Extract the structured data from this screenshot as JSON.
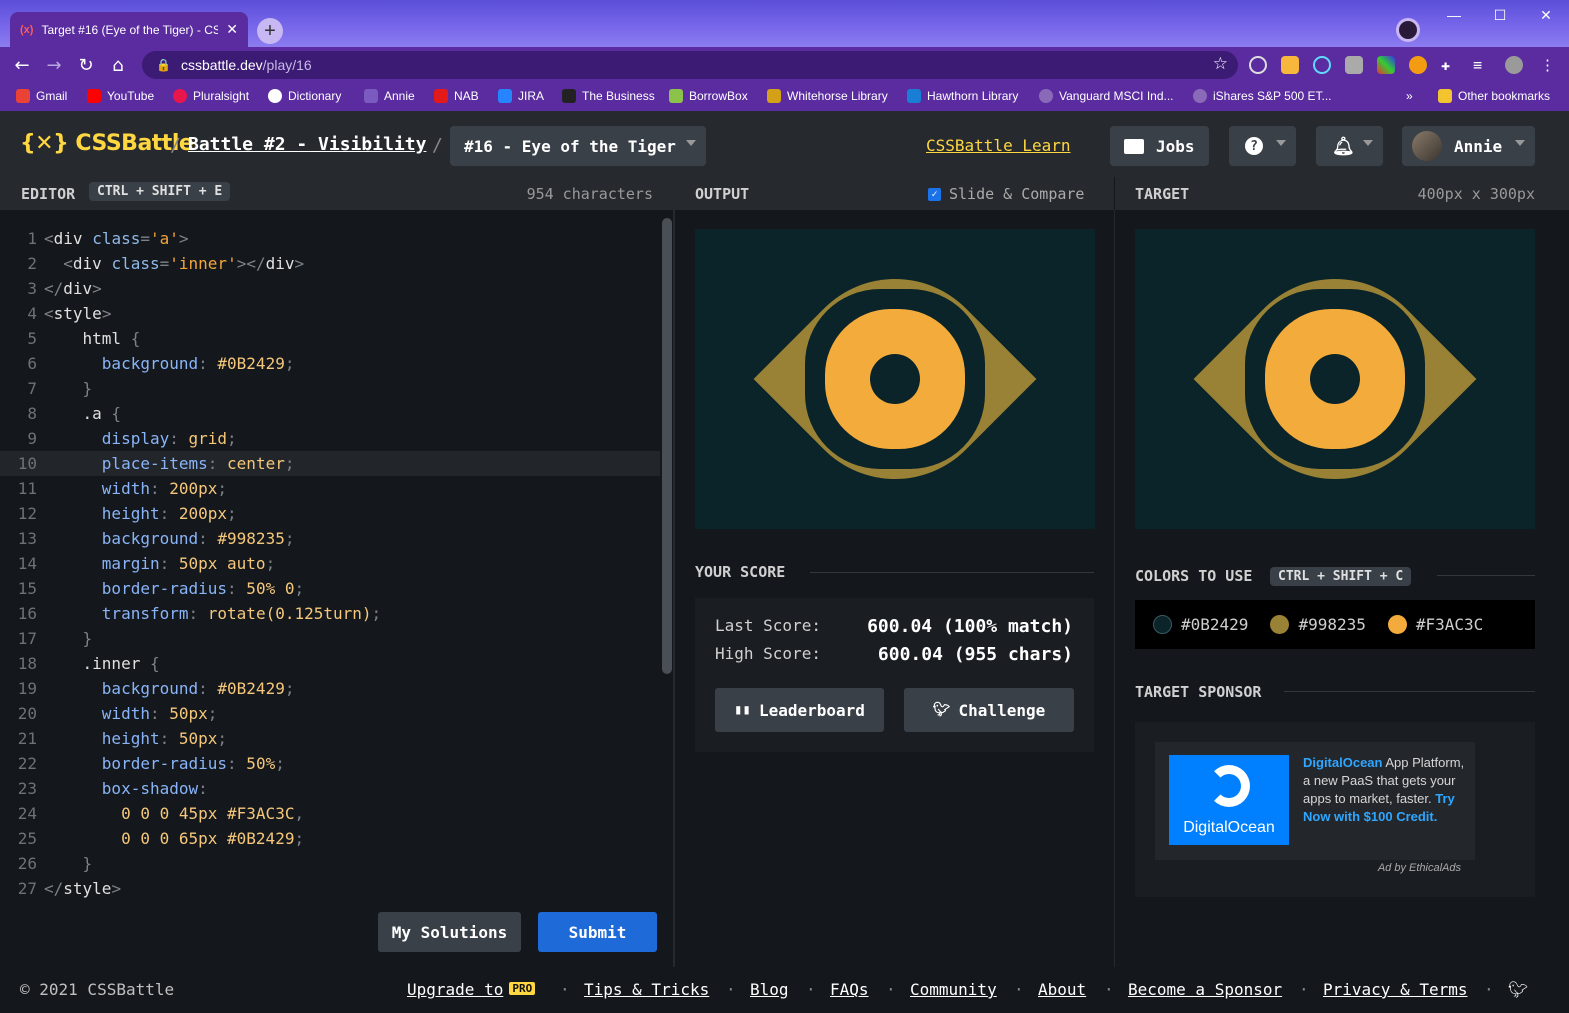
{
  "browser": {
    "tab_title": "Target #16 (Eye of the Tiger) - CSS",
    "tab_favicon": "(x)",
    "new_tab": "+",
    "url_host": "cssbattle.dev",
    "url_path": "/play/16",
    "more_bookmarks": "»",
    "bookmarks": [
      "Gmail",
      "YouTube",
      "Pluralsight",
      "Dictionary",
      "Annie",
      "NAB",
      "JIRA",
      "The Business",
      "BorrowBox",
      "Whitehorse Library",
      "Hawthorn Library",
      "Vanguard MSCI Ind...",
      "iShares S&P 500 ET...",
      "Other bookmarks"
    ]
  },
  "header": {
    "logo": "{✕} CSSBattle",
    "sep": "/",
    "battle": "Battle #2 - Visibility",
    "target": "#16 - Eye of the Tiger",
    "learn": "CSSBattle Learn",
    "jobs": "Jobs",
    "help": "?",
    "user": "Annie"
  },
  "editor": {
    "title": "EDITOR",
    "shortcut": "CTRL + SHIFT + E",
    "chars": "954 characters",
    "my_solutions": "My Solutions",
    "submit": "Submit"
  },
  "code_lines": [
    "<div class='a'>",
    "  <div class='inner'></div>",
    "</div>",
    "<style>",
    "    html {",
    "      background: #0B2429;",
    "    }",
    "    .a {",
    "      display: grid;",
    "      place-items: center;",
    "      width: 200px;",
    "      height: 200px;",
    "      background: #998235;",
    "      margin: 50px auto;",
    "      border-radius: 50% 0;",
    "      transform: rotate(0.125turn);",
    "    }",
    "    .inner {",
    "      background: #0B2429;",
    "      width: 50px;",
    "      height: 50px;",
    "      border-radius: 50%;",
    "      box-shadow:",
    "        0 0 0 45px #F3AC3C,",
    "        0 0 0 65px #0B2429;",
    "    }",
    "</style>"
  ],
  "output": {
    "title": "OUTPUT",
    "slide_compare": "Slide & Compare",
    "slide_checked": true
  },
  "target": {
    "title": "TARGET",
    "size": "400px x 300px"
  },
  "score": {
    "title": "YOUR SCORE",
    "last_label": "Last Score:",
    "last_value": "600.04 (100% match)",
    "high_label": "High Score:",
    "high_value": "600.04 (955 chars)",
    "leaderboard": "Leaderboard",
    "challenge": "Challenge"
  },
  "colors": {
    "title": "COLORS TO USE",
    "shortcut": "CTRL + SHIFT + C",
    "list": [
      {
        "label": "#0B2429",
        "hex": "#0B2429"
      },
      {
        "label": "#998235",
        "hex": "#998235"
      },
      {
        "label": "#F3AC3C",
        "hex": "#F3AC3C"
      }
    ]
  },
  "sponsor": {
    "title": "TARGET SPONSOR",
    "brand": "DigitalOcean",
    "text_1": "App Platform, a new PaaS that gets your apps to market, faster.",
    "cta": "Try Now with $100 Credit.",
    "ad_by": "Ad by EthicalAds"
  },
  "footer": {
    "copyright": "© 2021 CSSBattle",
    "upgrade": "Upgrade to",
    "pro": "PRO",
    "links": [
      "Tips & Tricks",
      "Blog",
      "FAQs",
      "Community",
      "About",
      "Become a Sponsor",
      "Privacy & Terms"
    ],
    "sep": "·"
  },
  "theme": {
    "accent": "#FFD740",
    "submit_blue": "#1E6AD8",
    "browser_purple": "#5A2CA0"
  }
}
